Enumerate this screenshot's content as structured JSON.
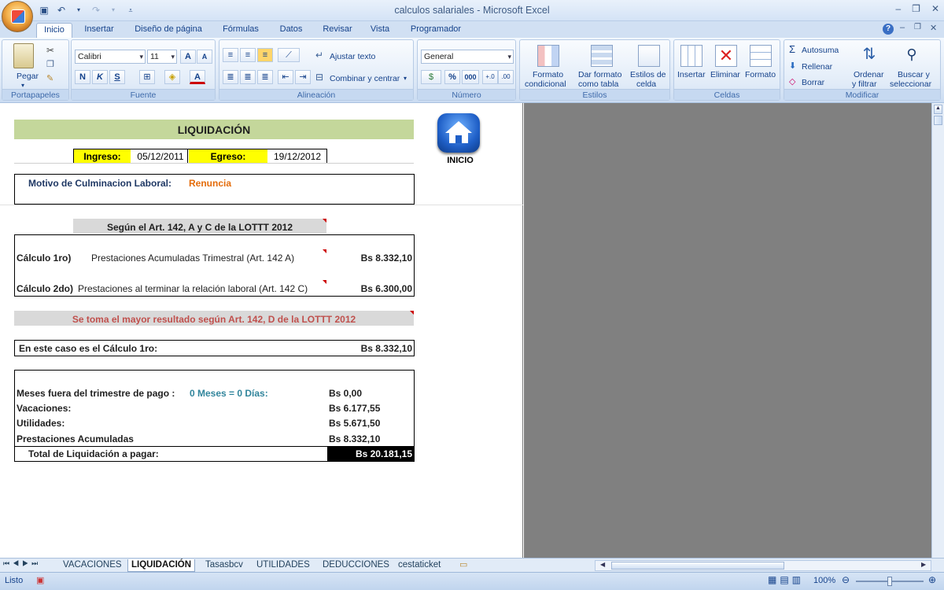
{
  "window": {
    "title": "calculos salariales - Microsoft Excel"
  },
  "tabs": [
    "Inicio",
    "Insertar",
    "Diseño de página",
    "Fórmulas",
    "Datos",
    "Revisar",
    "Vista",
    "Programador"
  ],
  "ribbon": {
    "groups": {
      "portapapeles": "Portapapeles",
      "fuente": "Fuente",
      "alineacion": "Alineación",
      "numero": "Número",
      "estilos": "Estilos",
      "celdas": "Celdas",
      "modificar": "Modificar"
    },
    "pegar": "Pegar",
    "font_name": "Calibri",
    "font_size": "11",
    "bold": "N",
    "italic": "K",
    "underline": "S",
    "ajustar_texto": "Ajustar texto",
    "combinar": "Combinar y centrar",
    "number_format": "General",
    "percent": "%",
    "thousands": "000",
    "formato_condicional_1": "Formato",
    "formato_condicional_2": "condicional",
    "dar_formato_1": "Dar formato",
    "dar_formato_2": "como tabla",
    "estilos_celda_1": "Estilos de",
    "estilos_celda_2": "celda",
    "insertar": "Insertar",
    "eliminar": "Eliminar",
    "formato": "Formato",
    "autosuma": "Autosuma",
    "rellenar": "Rellenar",
    "borrar": "Borrar",
    "ordenar_1": "Ordenar",
    "ordenar_2": "y filtrar",
    "buscar_1": "Buscar y",
    "buscar_2": "seleccionar"
  },
  "sheet": {
    "title": "LIQUIDACIÓN",
    "ingreso_label": "Ingreso:",
    "ingreso_value": "05/12/2011",
    "egreso_label": "Egreso:",
    "egreso_value": "19/12/2012",
    "home_label": "INICIO",
    "motivo_label": "Motivo de Culminacion Laboral:",
    "motivo_value": "Renuncia",
    "art_header": "Según el Art. 142, A y C de la LOTTT 2012",
    "calc1_label": "Cálculo 1ro)",
    "calc1_desc": "Prestaciones Acumuladas Trimestral (Art. 142 A)",
    "calc1_value": "Bs 8.332,10",
    "calc2_label": "Cálculo 2do)",
    "calc2_desc": "Prestaciones al terminar la relación laboral (Art. 142 C)",
    "calc2_value": "Bs 6.300,00",
    "mayor_note": "Se toma el mayor resultado según Art. 142, D de la LOTTT 2012",
    "caso_label": "En este caso es el  Cálculo 1ro:",
    "caso_value": "Bs 8.332,10",
    "meses_label": "Meses fuera del trimestre de pago :",
    "meses_dias": "0 Meses = 0 Días:",
    "meses_value": "Bs 0,00",
    "vacaciones_label": "Vacaciones:",
    "vacaciones_value": "Bs 6.177,55",
    "utilidades_label": "Utilidades:",
    "utilidades_value": "Bs 5.671,50",
    "prestaciones_label": "Prestaciones Acumuladas",
    "prestaciones_value": "Bs 8.332,10",
    "total_label": "Total de Liquidación a pagar:",
    "total_value": "Bs 20.181,15"
  },
  "sheet_tabs": [
    "VACACIONES",
    "LIQUIDACIÓN",
    "Tasasbcv",
    "UTILIDADES",
    "DEDUCCIONES",
    "cestaticket"
  ],
  "status": {
    "ready": "Listo",
    "zoom": "100%"
  },
  "colors": {
    "title_band": "#c4d79b",
    "yellow": "#ffff00",
    "art_band": "#d9d9d9",
    "orange_text": "#e46c0a",
    "red_text": "#c0504d",
    "teal_text": "#31859c"
  }
}
